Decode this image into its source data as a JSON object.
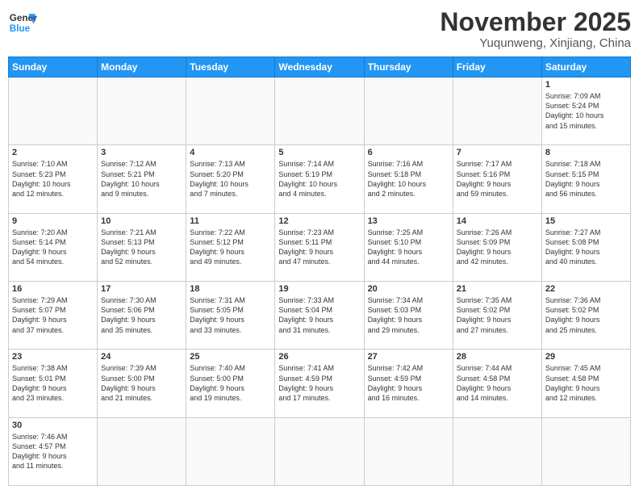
{
  "header": {
    "logo_general": "General",
    "logo_blue": "Blue",
    "month": "November 2025",
    "location": "Yuqunweng, Xinjiang, China"
  },
  "weekdays": [
    "Sunday",
    "Monday",
    "Tuesday",
    "Wednesday",
    "Thursday",
    "Friday",
    "Saturday"
  ],
  "weeks": [
    [
      {
        "day": "",
        "info": ""
      },
      {
        "day": "",
        "info": ""
      },
      {
        "day": "",
        "info": ""
      },
      {
        "day": "",
        "info": ""
      },
      {
        "day": "",
        "info": ""
      },
      {
        "day": "",
        "info": ""
      },
      {
        "day": "1",
        "info": "Sunrise: 7:09 AM\nSunset: 5:24 PM\nDaylight: 10 hours\nand 15 minutes."
      }
    ],
    [
      {
        "day": "2",
        "info": "Sunrise: 7:10 AM\nSunset: 5:23 PM\nDaylight: 10 hours\nand 12 minutes."
      },
      {
        "day": "3",
        "info": "Sunrise: 7:12 AM\nSunset: 5:21 PM\nDaylight: 10 hours\nand 9 minutes."
      },
      {
        "day": "4",
        "info": "Sunrise: 7:13 AM\nSunset: 5:20 PM\nDaylight: 10 hours\nand 7 minutes."
      },
      {
        "day": "5",
        "info": "Sunrise: 7:14 AM\nSunset: 5:19 PM\nDaylight: 10 hours\nand 4 minutes."
      },
      {
        "day": "6",
        "info": "Sunrise: 7:16 AM\nSunset: 5:18 PM\nDaylight: 10 hours\nand 2 minutes."
      },
      {
        "day": "7",
        "info": "Sunrise: 7:17 AM\nSunset: 5:16 PM\nDaylight: 9 hours\nand 59 minutes."
      },
      {
        "day": "8",
        "info": "Sunrise: 7:18 AM\nSunset: 5:15 PM\nDaylight: 9 hours\nand 56 minutes."
      }
    ],
    [
      {
        "day": "9",
        "info": "Sunrise: 7:20 AM\nSunset: 5:14 PM\nDaylight: 9 hours\nand 54 minutes."
      },
      {
        "day": "10",
        "info": "Sunrise: 7:21 AM\nSunset: 5:13 PM\nDaylight: 9 hours\nand 52 minutes."
      },
      {
        "day": "11",
        "info": "Sunrise: 7:22 AM\nSunset: 5:12 PM\nDaylight: 9 hours\nand 49 minutes."
      },
      {
        "day": "12",
        "info": "Sunrise: 7:23 AM\nSunset: 5:11 PM\nDaylight: 9 hours\nand 47 minutes."
      },
      {
        "day": "13",
        "info": "Sunrise: 7:25 AM\nSunset: 5:10 PM\nDaylight: 9 hours\nand 44 minutes."
      },
      {
        "day": "14",
        "info": "Sunrise: 7:26 AM\nSunset: 5:09 PM\nDaylight: 9 hours\nand 42 minutes."
      },
      {
        "day": "15",
        "info": "Sunrise: 7:27 AM\nSunset: 5:08 PM\nDaylight: 9 hours\nand 40 minutes."
      }
    ],
    [
      {
        "day": "16",
        "info": "Sunrise: 7:29 AM\nSunset: 5:07 PM\nDaylight: 9 hours\nand 37 minutes."
      },
      {
        "day": "17",
        "info": "Sunrise: 7:30 AM\nSunset: 5:06 PM\nDaylight: 9 hours\nand 35 minutes."
      },
      {
        "day": "18",
        "info": "Sunrise: 7:31 AM\nSunset: 5:05 PM\nDaylight: 9 hours\nand 33 minutes."
      },
      {
        "day": "19",
        "info": "Sunrise: 7:33 AM\nSunset: 5:04 PM\nDaylight: 9 hours\nand 31 minutes."
      },
      {
        "day": "20",
        "info": "Sunrise: 7:34 AM\nSunset: 5:03 PM\nDaylight: 9 hours\nand 29 minutes."
      },
      {
        "day": "21",
        "info": "Sunrise: 7:35 AM\nSunset: 5:02 PM\nDaylight: 9 hours\nand 27 minutes."
      },
      {
        "day": "22",
        "info": "Sunrise: 7:36 AM\nSunset: 5:02 PM\nDaylight: 9 hours\nand 25 minutes."
      }
    ],
    [
      {
        "day": "23",
        "info": "Sunrise: 7:38 AM\nSunset: 5:01 PM\nDaylight: 9 hours\nand 23 minutes."
      },
      {
        "day": "24",
        "info": "Sunrise: 7:39 AM\nSunset: 5:00 PM\nDaylight: 9 hours\nand 21 minutes."
      },
      {
        "day": "25",
        "info": "Sunrise: 7:40 AM\nSunset: 5:00 PM\nDaylight: 9 hours\nand 19 minutes."
      },
      {
        "day": "26",
        "info": "Sunrise: 7:41 AM\nSunset: 4:59 PM\nDaylight: 9 hours\nand 17 minutes."
      },
      {
        "day": "27",
        "info": "Sunrise: 7:42 AM\nSunset: 4:59 PM\nDaylight: 9 hours\nand 16 minutes."
      },
      {
        "day": "28",
        "info": "Sunrise: 7:44 AM\nSunset: 4:58 PM\nDaylight: 9 hours\nand 14 minutes."
      },
      {
        "day": "29",
        "info": "Sunrise: 7:45 AM\nSunset: 4:58 PM\nDaylight: 9 hours\nand 12 minutes."
      }
    ],
    [
      {
        "day": "30",
        "info": "Sunrise: 7:46 AM\nSunset: 4:57 PM\nDaylight: 9 hours\nand 11 minutes."
      },
      {
        "day": "",
        "info": ""
      },
      {
        "day": "",
        "info": ""
      },
      {
        "day": "",
        "info": ""
      },
      {
        "day": "",
        "info": ""
      },
      {
        "day": "",
        "info": ""
      },
      {
        "day": "",
        "info": ""
      }
    ]
  ]
}
